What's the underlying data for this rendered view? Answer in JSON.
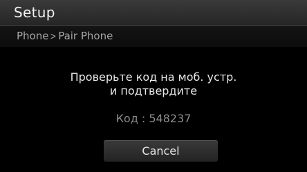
{
  "header": {
    "title": "Setup"
  },
  "breadcrumb": {
    "items": [
      "Phone",
      "Pair Phone"
    ],
    "separator": ">"
  },
  "dialog": {
    "message_line1": "Проверьте код на моб. устр.",
    "message_line2": "и подтвердите",
    "code_label": "Код",
    "code_separator": " : ",
    "code_value": "548237",
    "cancel_label": "Cancel"
  },
  "colors": {
    "background": "#000000",
    "title_bar": "#303030",
    "text_primary": "#e8e8e8",
    "text_secondary": "#8c8c8c"
  }
}
